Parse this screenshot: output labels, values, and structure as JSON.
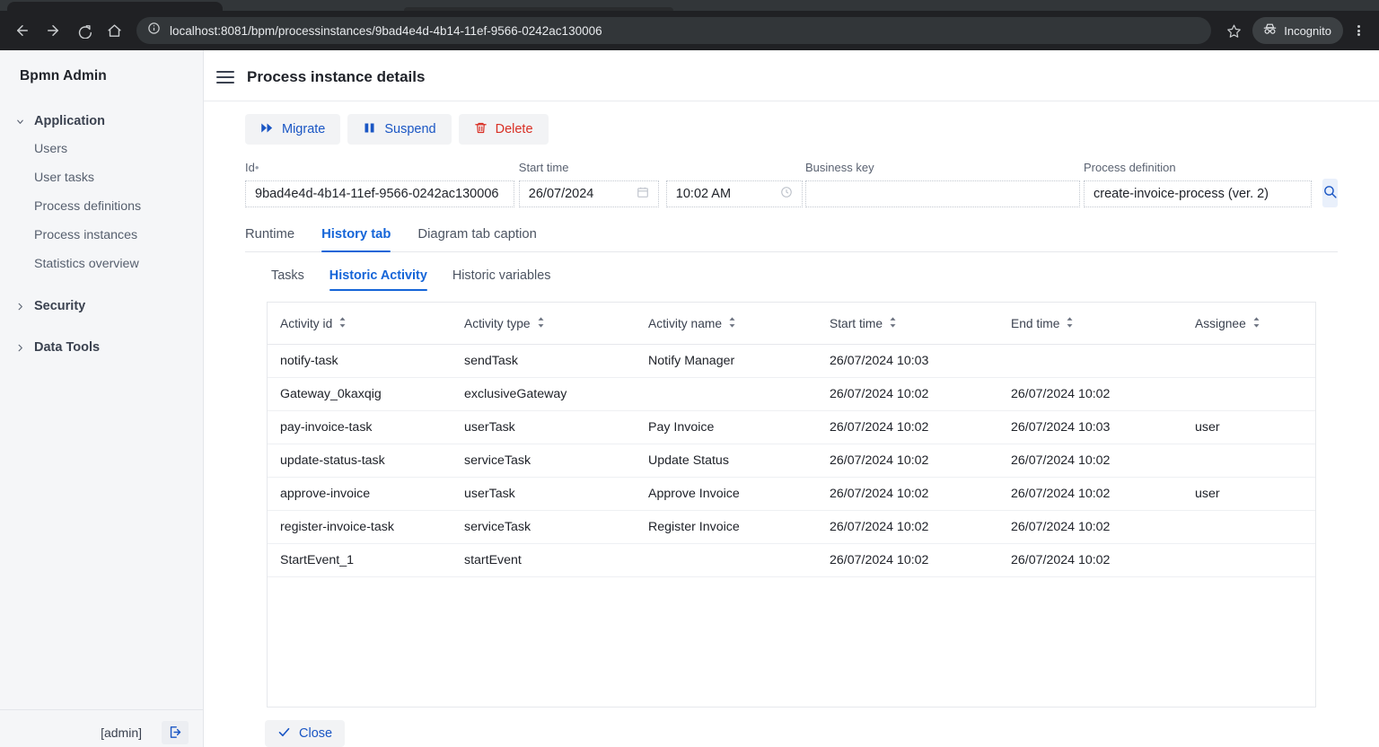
{
  "browser": {
    "url": "localhost:8081/bpm/processinstances/9bad4e4d-4b14-11ef-9566-0242ac130006",
    "profile_label": "Incognito",
    "back_icon": "back-arrow-icon",
    "forward_icon": "forward-arrow-icon",
    "reload_icon": "reload-icon",
    "home_icon": "home-icon",
    "info_icon": "page-info-icon",
    "bookmark_icon": "star-icon",
    "incognito_icon": "incognito-icon",
    "menu_icon": "kebab-menu-icon"
  },
  "sidebar": {
    "brand": "Bpmn Admin",
    "groups": [
      {
        "label": "Application",
        "expanded": true,
        "items": [
          "Users",
          "User tasks",
          "Process definitions",
          "Process instances",
          "Statistics overview"
        ]
      },
      {
        "label": "Security",
        "expanded": false,
        "items": []
      },
      {
        "label": "Data Tools",
        "expanded": false,
        "items": []
      }
    ],
    "user": "[admin]",
    "logout_icon": "logout-icon"
  },
  "header": {
    "menu_icon": "hamburger-menu-icon",
    "title": "Process instance details"
  },
  "toolbar": {
    "migrate_label": "Migrate",
    "migrate_icon": "fast-forward-icon",
    "suspend_label": "Suspend",
    "suspend_icon": "pause-icon",
    "delete_label": "Delete",
    "delete_icon": "trash-icon"
  },
  "fields": {
    "id": {
      "label": "Id",
      "required_marker": "•",
      "value": "9bad4e4d-4b14-11ef-9566-0242ac130006"
    },
    "start_time": {
      "label": "Start time",
      "date_value": "26/07/2024",
      "date_icon": "calendar-icon",
      "time_value": "10:02 AM",
      "time_icon": "clock-icon"
    },
    "business_key": {
      "label": "Business key",
      "value": "",
      "placeholder": ""
    },
    "process_definition": {
      "label": "Process definition",
      "value": "create-invoice-process (ver. 2)"
    },
    "search_icon": "search-icon"
  },
  "tabs": {
    "primary": [
      {
        "label": "Runtime",
        "active": false
      },
      {
        "label": "History tab",
        "active": true
      },
      {
        "label": "Diagram tab caption",
        "active": false
      }
    ],
    "secondary": [
      {
        "label": "Tasks",
        "active": false
      },
      {
        "label": "Historic Activity",
        "active": true
      },
      {
        "label": "Historic variables",
        "active": false
      }
    ]
  },
  "table": {
    "sort_icon": "sort-updown-icon",
    "columns": [
      "Activity id",
      "Activity type",
      "Activity name",
      "Start time",
      "End time",
      "Assignee"
    ],
    "rows": [
      [
        "notify-task",
        "sendTask",
        "Notify Manager",
        "26/07/2024 10:03",
        "",
        ""
      ],
      [
        "Gateway_0kaxqig",
        "exclusiveGateway",
        "",
        "26/07/2024 10:02",
        "26/07/2024 10:02",
        ""
      ],
      [
        "pay-invoice-task",
        "userTask",
        "Pay Invoice",
        "26/07/2024 10:02",
        "26/07/2024 10:03",
        "user"
      ],
      [
        "update-status-task",
        "serviceTask",
        "Update Status",
        "26/07/2024 10:02",
        "26/07/2024 10:02",
        ""
      ],
      [
        "approve-invoice",
        "userTask",
        "Approve Invoice",
        "26/07/2024 10:02",
        "26/07/2024 10:02",
        "user"
      ],
      [
        "register-invoice-task",
        "serviceTask",
        "Register Invoice",
        "26/07/2024 10:02",
        "26/07/2024 10:02",
        ""
      ],
      [
        "StartEvent_1",
        "startEvent",
        "",
        "26/07/2024 10:02",
        "26/07/2024 10:02",
        ""
      ]
    ]
  },
  "footer": {
    "close_label": "Close",
    "close_icon": "check-icon"
  },
  "colors": {
    "accent": "#1565d8",
    "link": "#1a56c4",
    "danger": "#d93025",
    "sidebar_bg": "#f5f6f8",
    "browser_bg": "#202124"
  }
}
